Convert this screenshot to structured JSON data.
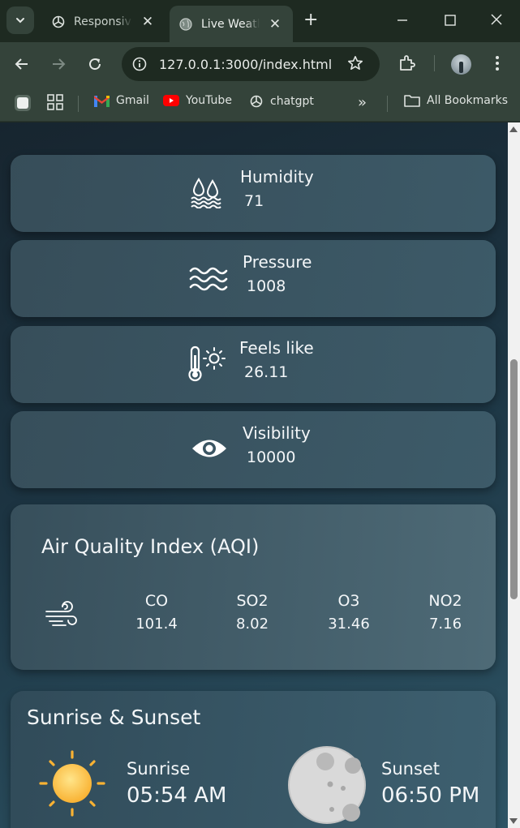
{
  "browser": {
    "tabs": [
      {
        "title": "Responsive"
      },
      {
        "title": "Live Weath"
      }
    ],
    "url": "127.0.0.1:3000/index.html",
    "bookmarks": [
      "Gmail",
      "YouTube",
      "chatgpt"
    ],
    "all_bookmarks": "All Bookmarks"
  },
  "stats": [
    {
      "label": "Humidity",
      "value": "71",
      "icon": "humidity-icon"
    },
    {
      "label": "Pressure",
      "value": "1008",
      "icon": "wind-waves-icon"
    },
    {
      "label": "Feels like",
      "value": "26.11",
      "icon": "thermometer-sun-icon"
    },
    {
      "label": "Visibility",
      "value": "10000",
      "icon": "eye-icon"
    }
  ],
  "aqi": {
    "title": "Air Quality Index (AQI)",
    "components": [
      {
        "name": "CO",
        "value": "101.4"
      },
      {
        "name": "SO2",
        "value": "8.02"
      },
      {
        "name": "O3",
        "value": "31.46"
      },
      {
        "name": "NO2",
        "value": "7.16"
      }
    ]
  },
  "sun": {
    "title": "Sunrise & Sunset",
    "sunrise_label": "Sunrise",
    "sunrise_time": "05:54 AM",
    "sunset_label": "Sunset",
    "sunset_time": "06:50 PM"
  }
}
